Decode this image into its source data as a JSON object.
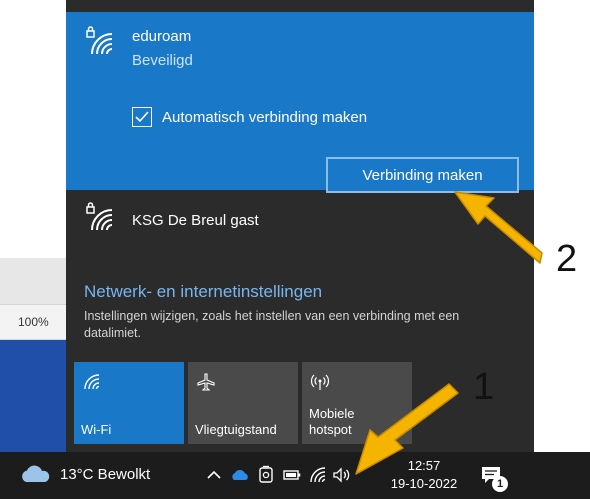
{
  "background": {
    "zoom_label": "100%"
  },
  "flyout": {
    "selected_network": {
      "name": "eduroam",
      "status": "Beveiligd",
      "auto_connect_label": "Automatisch verbinding maken",
      "auto_connect_checked": true,
      "connect_button": "Verbinding maken",
      "icon": "wifi-secured-icon"
    },
    "other_networks": [
      {
        "name": "KSG De Breul gast",
        "icon": "wifi-secured-icon"
      }
    ],
    "settings": {
      "link": "Netwerk- en internetinstellingen",
      "description": "Instellingen wijzigen, zoals het instellen van een verbinding met een datalimiet."
    },
    "quick_actions": [
      {
        "label": "Wi-Fi",
        "label_top": "",
        "icon": "wifi-icon",
        "active": true
      },
      {
        "label": "Vliegtuigstand",
        "label_top": "",
        "icon": "airplane-icon",
        "active": false
      },
      {
        "label": "hotspot",
        "label_top": "Mobiele",
        "icon": "mobile-hotspot-icon",
        "active": false
      }
    ]
  },
  "taskbar": {
    "weather": "13°C  Bewolkt",
    "time": "12:57",
    "date": "19-10-2022",
    "notification_count": "1"
  },
  "annotations": {
    "step_1": "1",
    "step_2": "2"
  },
  "colors": {
    "accent": "#1a78c8",
    "flyout_bg": "#2b2b2b",
    "taskbar_bg": "#1c1c1c",
    "link": "#78b6f0",
    "arrow": "#f5b400"
  }
}
